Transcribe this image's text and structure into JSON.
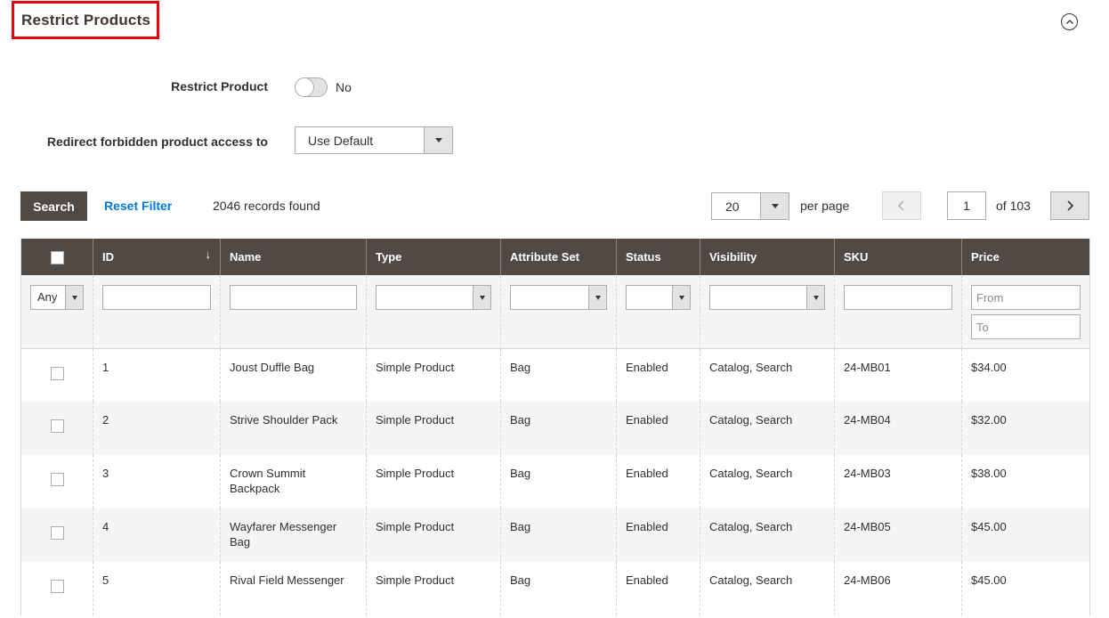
{
  "section": {
    "title": "Restrict Products",
    "collapse_icon": "chevron-up-circle-icon"
  },
  "form": {
    "restrict_product": {
      "label": "Restrict Product",
      "value": "No",
      "enabled": false
    },
    "redirect": {
      "label": "Redirect forbidden product access to",
      "value": "Use Default"
    }
  },
  "toolbar": {
    "search_label": "Search",
    "reset_label": "Reset Filter",
    "records_found": "2046 records found",
    "per_page_value": "20",
    "per_page_label": "per page",
    "current_page": "1",
    "total_pages_label": "of 103",
    "prev_icon": "chevron-left-icon",
    "next_icon": "chevron-right-icon"
  },
  "grid": {
    "columns": [
      "",
      "ID",
      "Name",
      "Type",
      "Attribute Set",
      "Status",
      "Visibility",
      "SKU",
      "Price"
    ],
    "sort_indicator": "↓",
    "filters": {
      "in_products": "Any",
      "id": "",
      "name": "",
      "type": "",
      "attribute_set": "",
      "status": "",
      "visibility": "",
      "sku": "",
      "price_from_placeholder": "From",
      "price_to_placeholder": "To"
    },
    "rows": [
      {
        "checked": false,
        "id": "1",
        "name": "Joust Duffle Bag",
        "type": "Simple Product",
        "attribute_set": "Bag",
        "status": "Enabled",
        "visibility": "Catalog, Search",
        "sku": "24-MB01",
        "price": "$34.00"
      },
      {
        "checked": false,
        "id": "2",
        "name": "Strive Shoulder Pack",
        "type": "Simple Product",
        "attribute_set": "Bag",
        "status": "Enabled",
        "visibility": "Catalog, Search",
        "sku": "24-MB04",
        "price": "$32.00"
      },
      {
        "checked": false,
        "id": "3",
        "name": "Crown Summit Backpack",
        "type": "Simple Product",
        "attribute_set": "Bag",
        "status": "Enabled",
        "visibility": "Catalog, Search",
        "sku": "24-MB03",
        "price": "$38.00"
      },
      {
        "checked": false,
        "id": "4",
        "name": "Wayfarer Messenger Bag",
        "type": "Simple Product",
        "attribute_set": "Bag",
        "status": "Enabled",
        "visibility": "Catalog, Search",
        "sku": "24-MB05",
        "price": "$45.00"
      },
      {
        "checked": false,
        "id": "5",
        "name": "Rival Field Messenger",
        "type": "Simple Product",
        "attribute_set": "Bag",
        "status": "Enabled",
        "visibility": "Catalog, Search",
        "sku": "24-MB06",
        "price": "$45.00"
      }
    ]
  },
  "colors": {
    "header_bg": "#514943",
    "link": "#007bdb",
    "highlight_border": "#e8020d"
  }
}
